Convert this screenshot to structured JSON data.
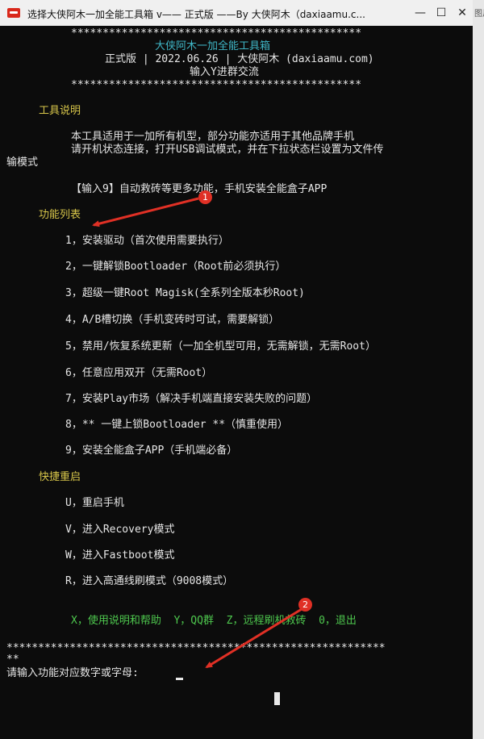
{
  "window": {
    "title": "选择大侠阿木一加全能工具箱 v—— 正式版 ——By 大侠阿木（daxiaamu.c...",
    "minimize_icon": "minimize-icon",
    "maximize_icon": "maximize-icon",
    "close_icon": "close-icon"
  },
  "side": {
    "text": "图片 · 径浏"
  },
  "header": {
    "stars_top": "**********************************************",
    "title": "大侠阿木一加全能工具箱",
    "version_line": "正式版 | 2022.06.26 | 大侠阿木 (daxiaamu.com)",
    "join_group": "输入Y进群交流",
    "stars_bottom": "**********************************************"
  },
  "tools": {
    "heading": "工具说明",
    "desc_line1": "本工具适用于一加所有机型，部分功能亦适用于其他品牌手机",
    "desc_line2": "请开机状态连接，打开USB调试模式，并在下拉状态栏设置为文件传",
    "desc_line3": "输模式",
    "tip": "【输入9】自动救砖等更多功能，手机安装全能盒子APP"
  },
  "functions": {
    "heading": "功能列表",
    "items": [
      "1，安装驱动（首次使用需要执行）",
      "2，一键解锁Bootloader（Root前必须执行）",
      "3，超级一键Root Magisk(全系列全版本秒Root)",
      "4，A/B槽切换（手机变砖时可试，需要解锁）",
      "5，禁用/恢复系统更新（一加全机型可用，无需解锁，无需Root）",
      "6，任意应用双开（无需Root）",
      "7，安装Play市场（解决手机端直接安装失败的问题）",
      "8，** 一键上锁Bootloader **（慎重使用）",
      "9，安装全能盒子APP（手机端必备）"
    ]
  },
  "reboot": {
    "heading": "快捷重启",
    "items": [
      "U，重启手机",
      "V，进入Recovery模式",
      "W，进入Fastboot模式",
      "R，进入高通线刷模式（9008模式）"
    ]
  },
  "footer": {
    "options": "X，使用说明和帮助  Y，QQ群  Z，远程刷机救砖  0，退出",
    "stars_line1": "************************************************************",
    "stars_line2": "**",
    "prompt": "请输入功能对应数字或字母:"
  },
  "annotations": {
    "marker1": "1",
    "marker2": "2",
    "color": "#e03025"
  }
}
